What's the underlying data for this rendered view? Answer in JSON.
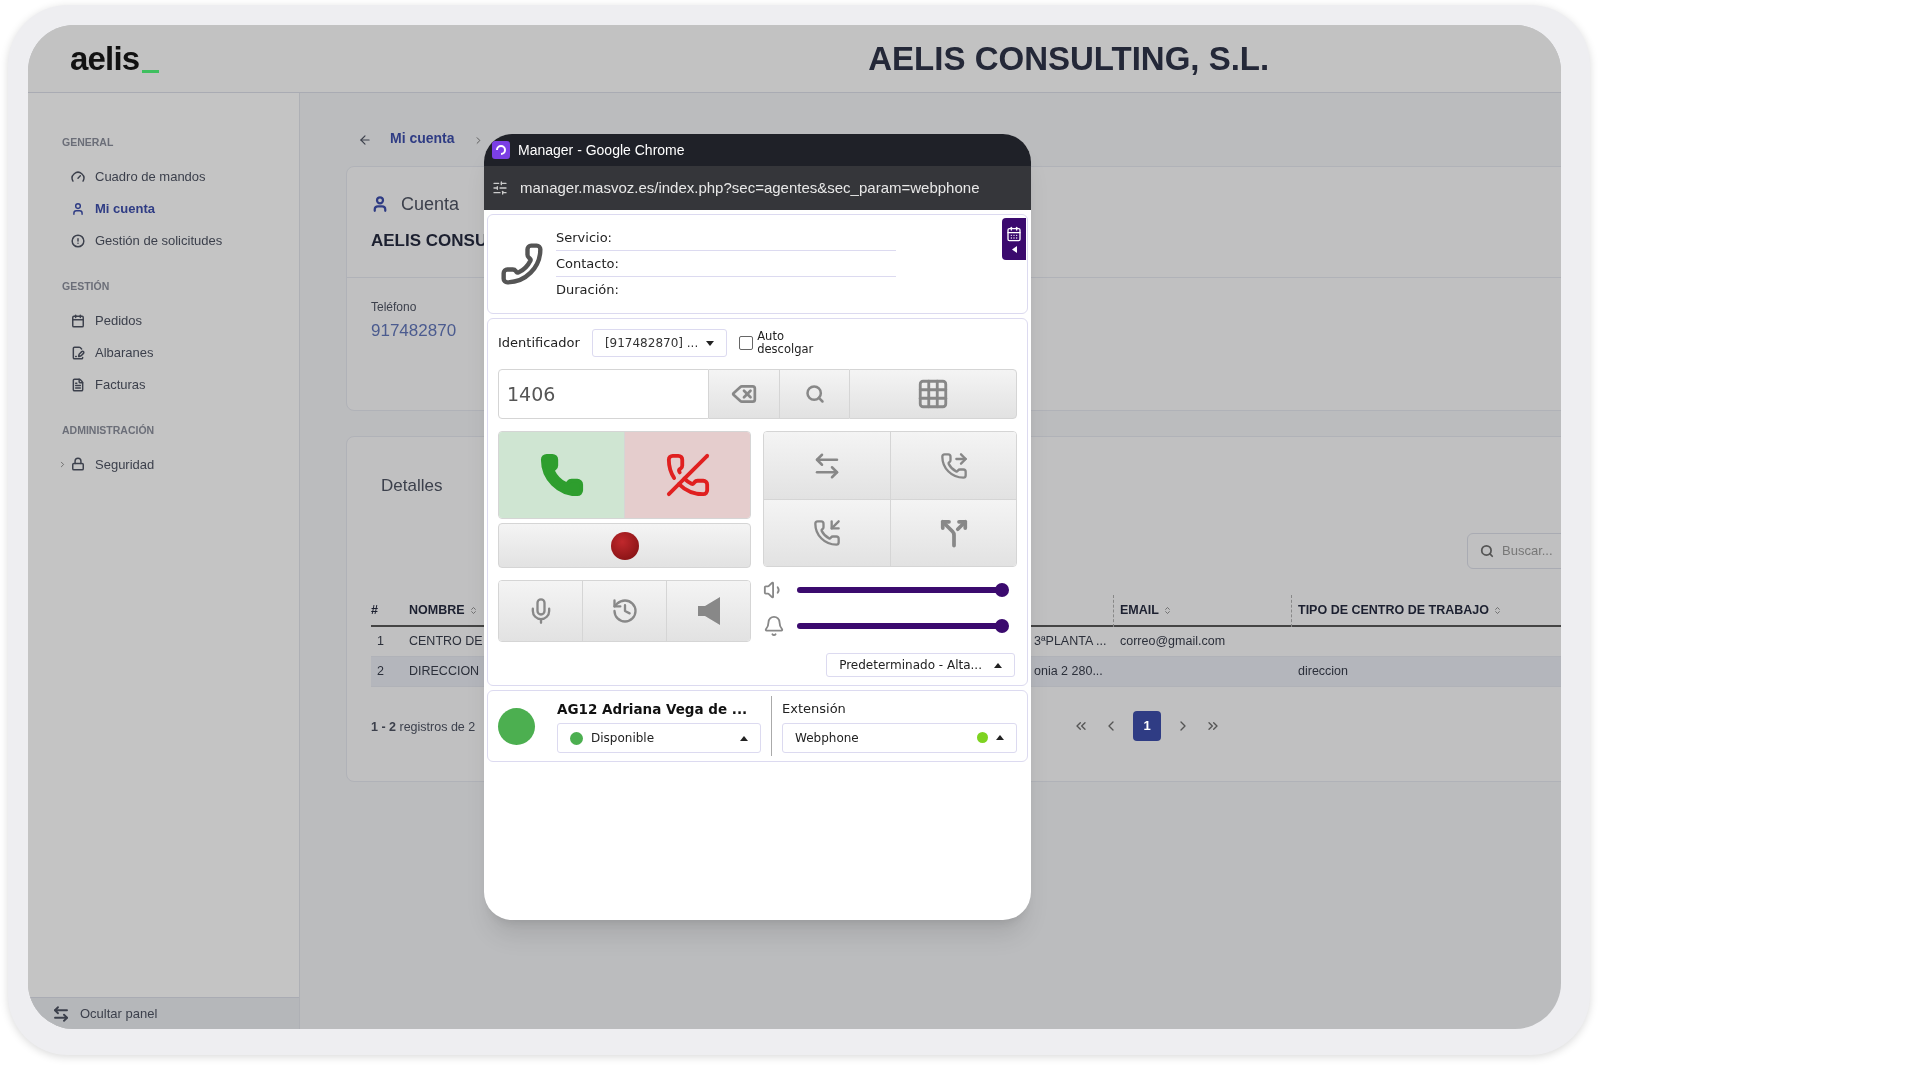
{
  "header": {
    "logo": "aelis",
    "title": "AELIS CONSULTING, S.L."
  },
  "sidebar": {
    "sections": [
      {
        "heading": "GENERAL",
        "items": [
          {
            "label": "Cuadro de mandos",
            "selected": false
          },
          {
            "label": "Mi cuenta",
            "selected": true
          },
          {
            "label": "Gestión de solicitudes",
            "selected": false
          }
        ]
      },
      {
        "heading": "GESTIÓN",
        "items": [
          {
            "label": "Pedidos",
            "selected": false
          },
          {
            "label": "Albaranes",
            "selected": false
          },
          {
            "label": "Facturas",
            "selected": false
          }
        ]
      },
      {
        "heading": "ADMINISTRACIÓN",
        "items": [
          {
            "label": "Seguridad",
            "selected": false,
            "expanded": false
          }
        ]
      }
    ],
    "footer": "Ocultar panel"
  },
  "breadcrumb": [
    "Mi cuenta"
  ],
  "account_card": {
    "heading": "Cuenta",
    "name": "AELIS CONSU",
    "fields": [
      {
        "label": "Teléfono",
        "value": "917482870"
      }
    ]
  },
  "details_card": {
    "tab": "Detalles",
    "search": {
      "placeholder": "Buscar..."
    },
    "table": {
      "columns": [
        "#",
        "NOMBRE",
        "EMAIL",
        "TIPO DE CENTRO DE TRABAJO"
      ],
      "rows": [
        {
          "number": "1",
          "nombre": "CENTRO DE",
          "column_3": "3ªPLANTA ...",
          "email": "correo@gmail.com",
          "selected": false
        },
        {
          "number": "2",
          "nombre": "DIRECCION",
          "column_3": "onia 2 280...",
          "tipo": "direccion",
          "selected": true
        }
      ]
    },
    "pagination": {
      "summary": "**1 - 2** registros de 2",
      "pages": [
        {
          "label": "1",
          "selected": true
        }
      ]
    }
  },
  "webphone": {
    "window_title": "Manager - Google Chrome",
    "url": "manager.masvoz.es/index.php?sec=agentes&sec_param=webphone",
    "call_info": [
      "Servicio:",
      "Contacto:",
      "Duración:"
    ],
    "identifier": {
      "label": "Identificador",
      "value": "[917482870] ..."
    },
    "auto_answer": {
      "label": "Auto descolgar",
      "checked": false
    },
    "dial": {
      "value": "1406"
    },
    "volume": {
      "level": 1
    },
    "ringer": {
      "level": 1
    },
    "audio_device": "Predeterminado - Alta...",
    "agent": {
      "name": "AG12 Adriana Vega de ...",
      "color": "#4caf50",
      "status": {
        "label": "Disponible",
        "color": "#4caf50"
      }
    },
    "extension": {
      "label": "Extensión",
      "value": "Webphone",
      "color": "#7ed321"
    }
  }
}
